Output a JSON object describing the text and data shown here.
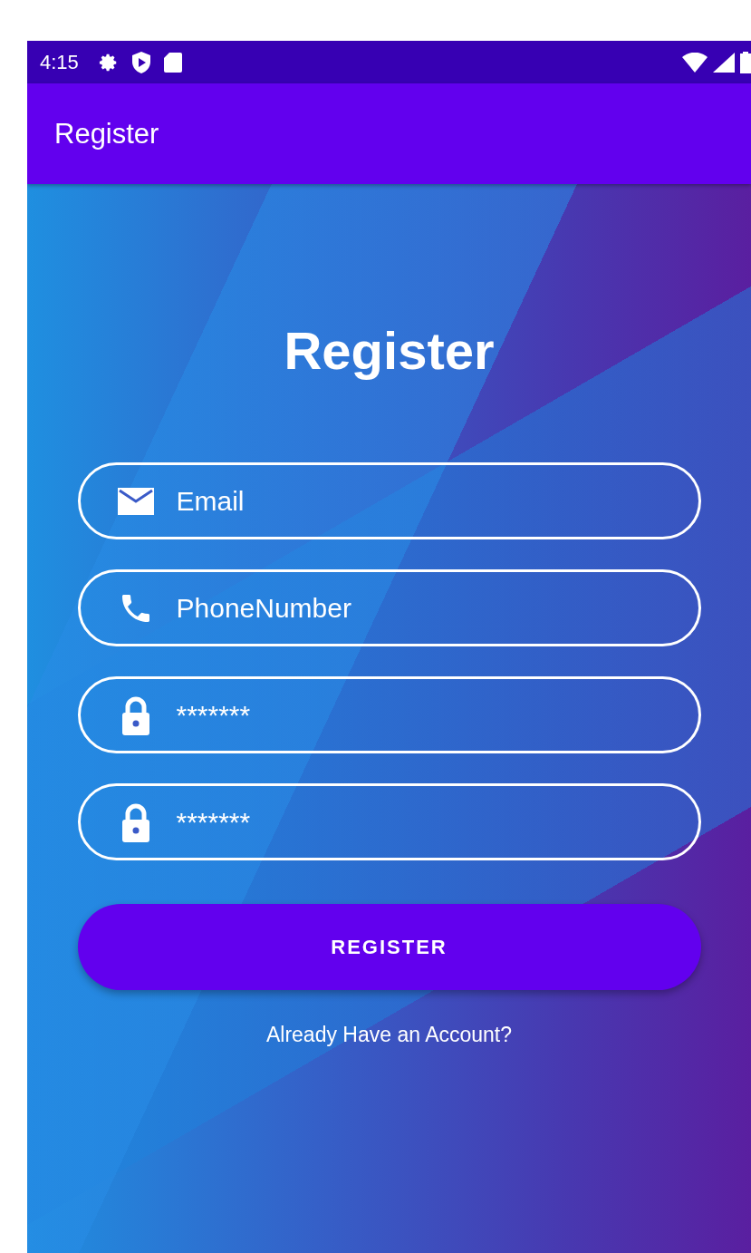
{
  "status_bar": {
    "time": "4:15"
  },
  "app_bar": {
    "title": "Register"
  },
  "heading": "Register",
  "fields": [
    {
      "kind": "email",
      "placeholder": "Email"
    },
    {
      "kind": "phone",
      "placeholder": "PhoneNumber"
    },
    {
      "kind": "password",
      "placeholder": "*******"
    },
    {
      "kind": "password",
      "placeholder": "*******"
    }
  ],
  "button": "REGISTER",
  "link": "Already Have an Account?"
}
